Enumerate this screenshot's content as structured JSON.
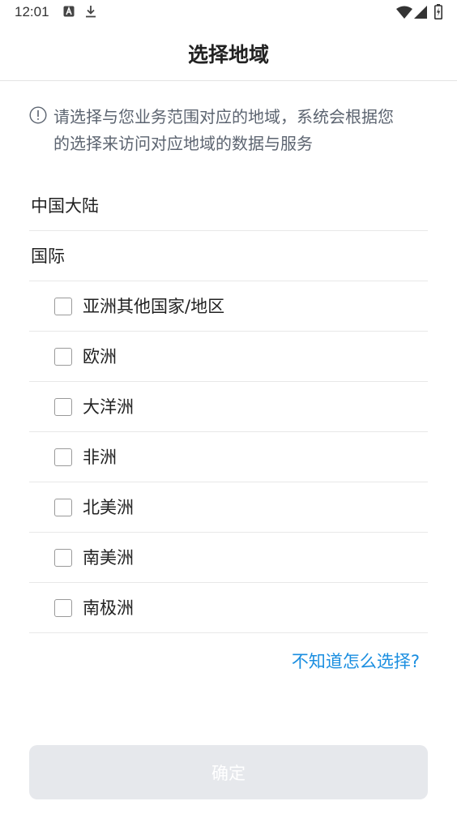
{
  "status_bar": {
    "time": "12:01",
    "icons": [
      "notification-a-icon",
      "download-icon",
      "wifi-icon",
      "signal-icon",
      "battery-charging-icon"
    ]
  },
  "header": {
    "title": "选择地域"
  },
  "notice": {
    "icon": "info-circle-icon",
    "line1": "请选择与您业务范围对应的地域，系统会根据您",
    "line2": "的选择来访问对应地域的数据与服务"
  },
  "regions": {
    "mainland": "中国大陆",
    "international": "国际",
    "international_items": [
      {
        "label": "亚洲其他国家/地区",
        "checked": false
      },
      {
        "label": "欧洲",
        "checked": false
      },
      {
        "label": "大洋洲",
        "checked": false
      },
      {
        "label": "非洲",
        "checked": false
      },
      {
        "label": "北美洲",
        "checked": false
      },
      {
        "label": "南美洲",
        "checked": false
      },
      {
        "label": "南极洲",
        "checked": false
      }
    ]
  },
  "help_link": "不知道怎么选择?",
  "confirm_button": {
    "label": "确定",
    "enabled": false
  },
  "colors": {
    "link": "#1a8ee0",
    "button_disabled_bg": "#e6e8ec",
    "notice_text": "#5c6470"
  }
}
